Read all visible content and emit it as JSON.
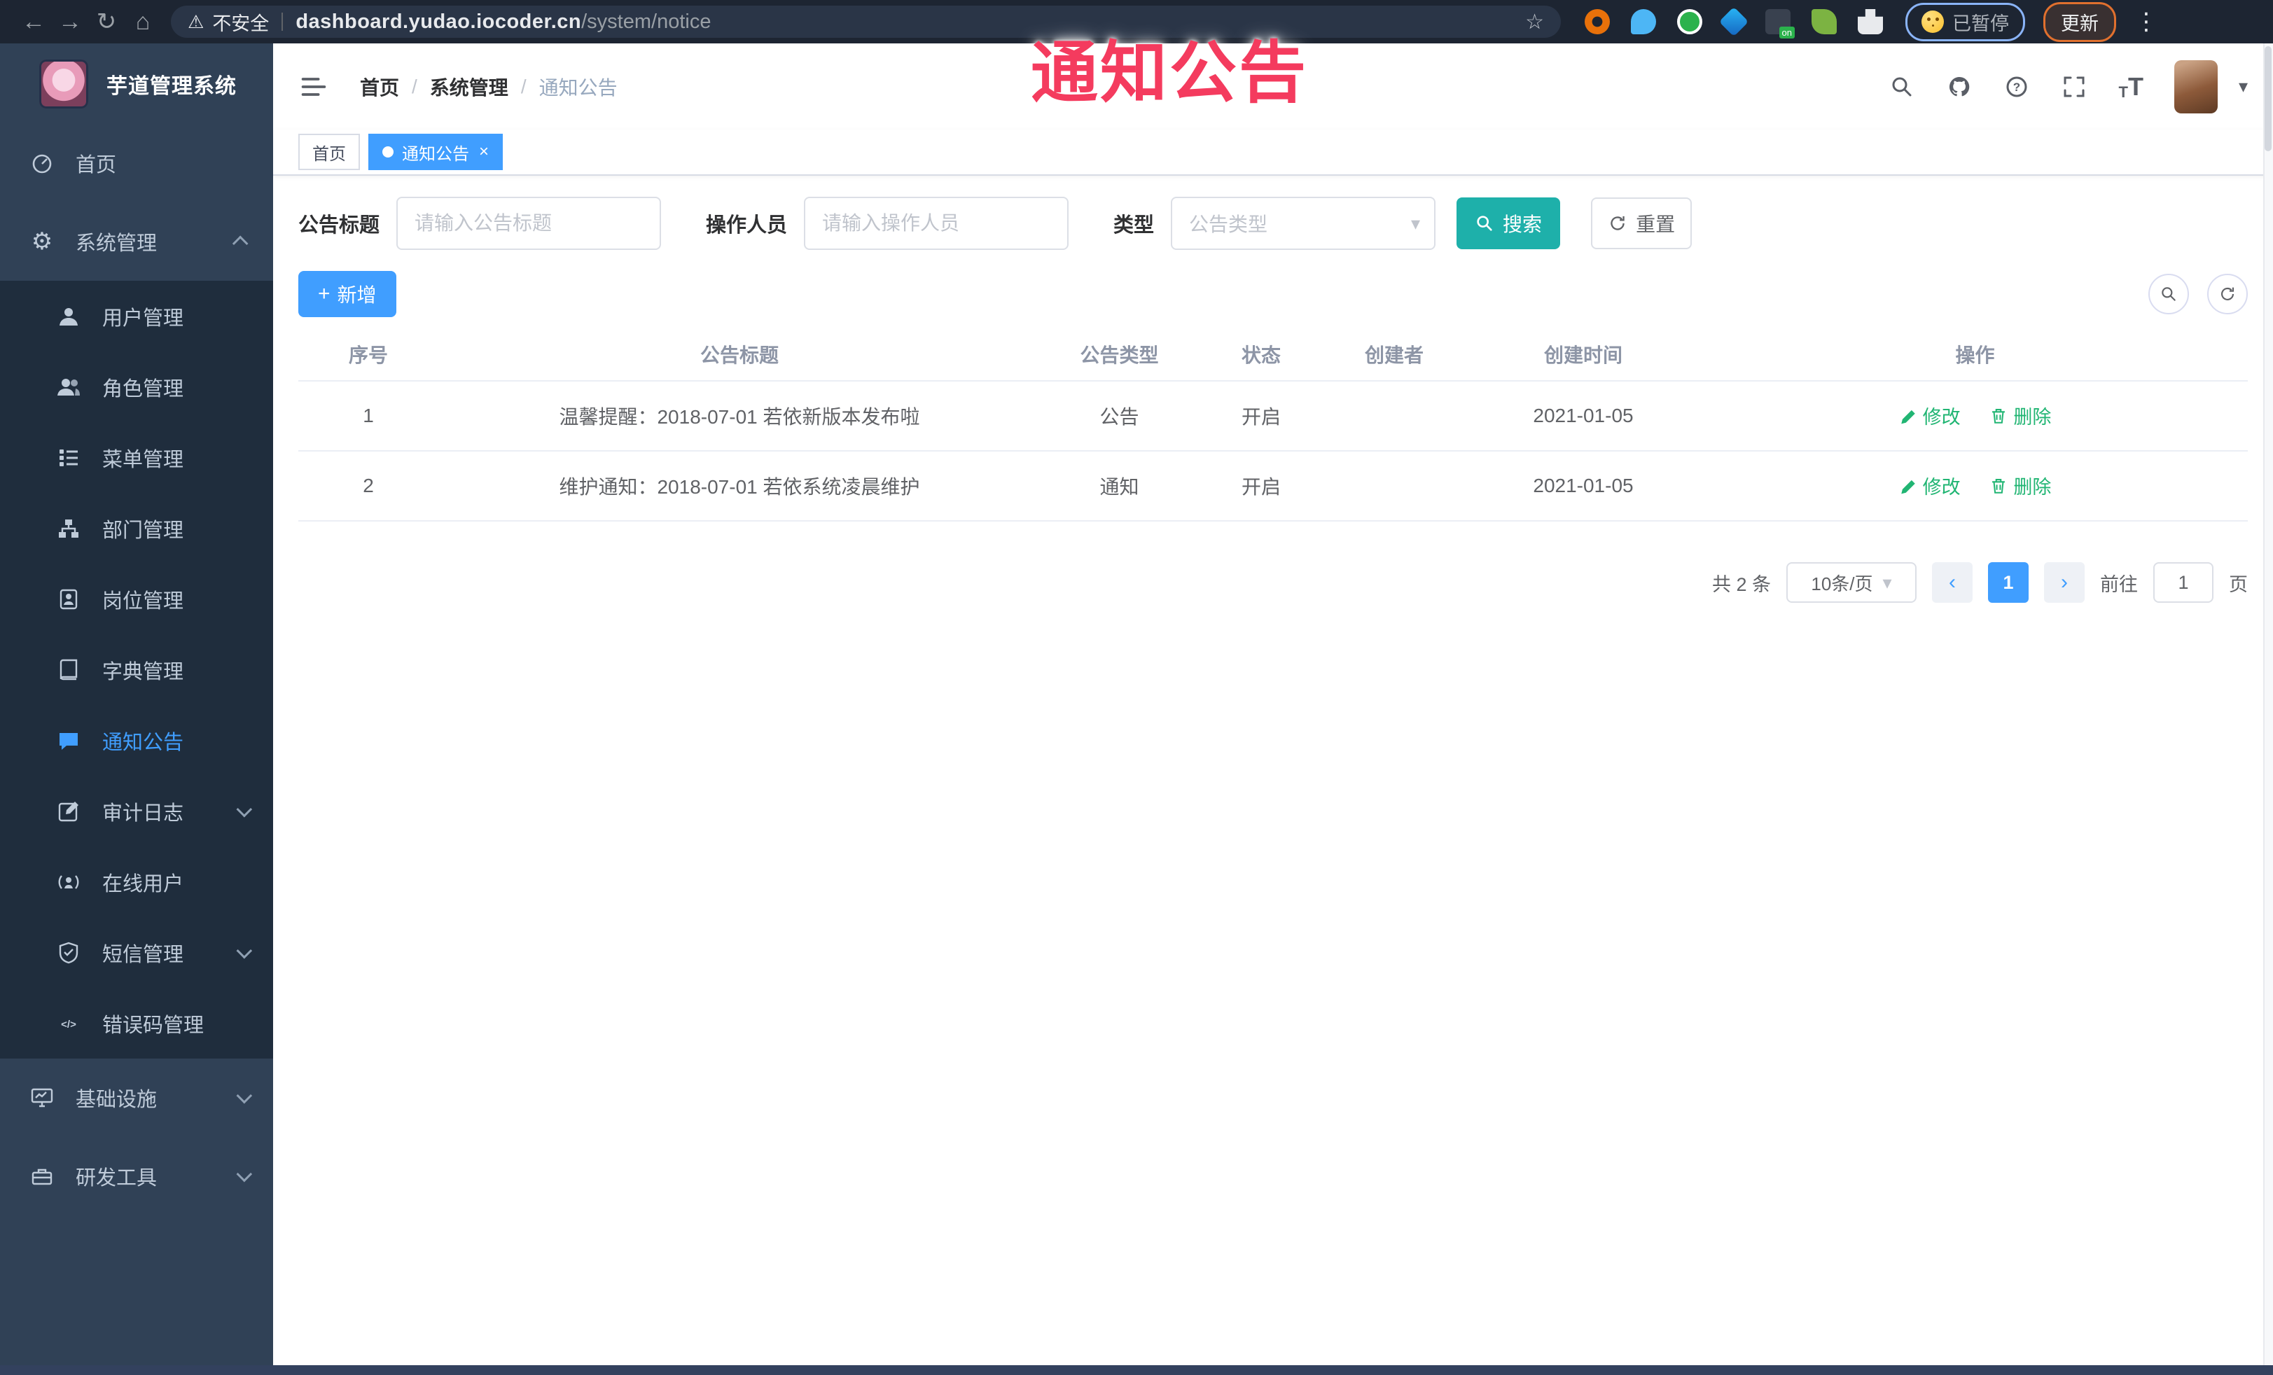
{
  "browser": {
    "security_label": "不安全",
    "url_host": "dashboard.yudao.iocoder.cn",
    "url_path": "/system/notice",
    "paused_label": "已暂停",
    "update_label": "更新"
  },
  "icons": {
    "back": "←",
    "forward": "→",
    "refresh": "↻",
    "home": "⌂",
    "warning": "⚠",
    "star": "☆",
    "menu_dots": "⋮",
    "gear": "⚙",
    "caret_down": "▾",
    "close": "×",
    "plus": "+",
    "prev": "‹",
    "next": "›"
  },
  "overlay": {
    "title": "通知公告",
    "color": "#f43b5e"
  },
  "sidebar": {
    "app_title": "芋道管理系统",
    "items": [
      {
        "label": "首页"
      },
      {
        "label": "系统管理"
      },
      {
        "label": "用户管理"
      },
      {
        "label": "角色管理"
      },
      {
        "label": "菜单管理"
      },
      {
        "label": "部门管理"
      },
      {
        "label": "岗位管理"
      },
      {
        "label": "字典管理"
      },
      {
        "label": "通知公告"
      },
      {
        "label": "审计日志"
      },
      {
        "label": "在线用户"
      },
      {
        "label": "短信管理"
      },
      {
        "label": "错误码管理"
      },
      {
        "label": "基础设施"
      },
      {
        "label": "研发工具"
      }
    ]
  },
  "header": {
    "breadcrumb": [
      "首页",
      "系统管理",
      "通知公告"
    ]
  },
  "tabs": [
    {
      "label": "首页",
      "active": false
    },
    {
      "label": "通知公告",
      "active": true
    }
  ],
  "filters": {
    "title_label": "公告标题",
    "title_placeholder": "请输入公告标题",
    "operator_label": "操作人员",
    "operator_placeholder": "请输入操作人员",
    "type_label": "类型",
    "type_placeholder": "公告类型",
    "search_label": "搜索",
    "reset_label": "重置"
  },
  "toolbar": {
    "add_label": "新增"
  },
  "table": {
    "headers": [
      "序号",
      "公告标题",
      "公告类型",
      "状态",
      "创建者",
      "创建时间",
      "操作"
    ],
    "edit_label": "修改",
    "delete_label": "删除",
    "rows": [
      {
        "no": "1",
        "title": "温馨提醒：2018-07-01 若依新版本发布啦",
        "type": "公告",
        "status": "开启",
        "creator": "",
        "created": "2021-01-05"
      },
      {
        "no": "2",
        "title": "维护通知：2018-07-01 若依系统凌晨维护",
        "type": "通知",
        "status": "开启",
        "creator": "",
        "created": "2021-01-05"
      }
    ]
  },
  "pagination": {
    "total": "共 2 条",
    "page_size": "10条/页",
    "current": "1",
    "goto_label": "前往",
    "goto_value": "1",
    "page_unit": "页"
  },
  "colors": {
    "accent_blue": "#409eff",
    "search_teal": "#1eb0aa",
    "link_green": "#21b573",
    "sidebar_bg": "#304156",
    "sidebar_sub_bg": "#1f2d3d",
    "tab_active": "#409eff"
  }
}
